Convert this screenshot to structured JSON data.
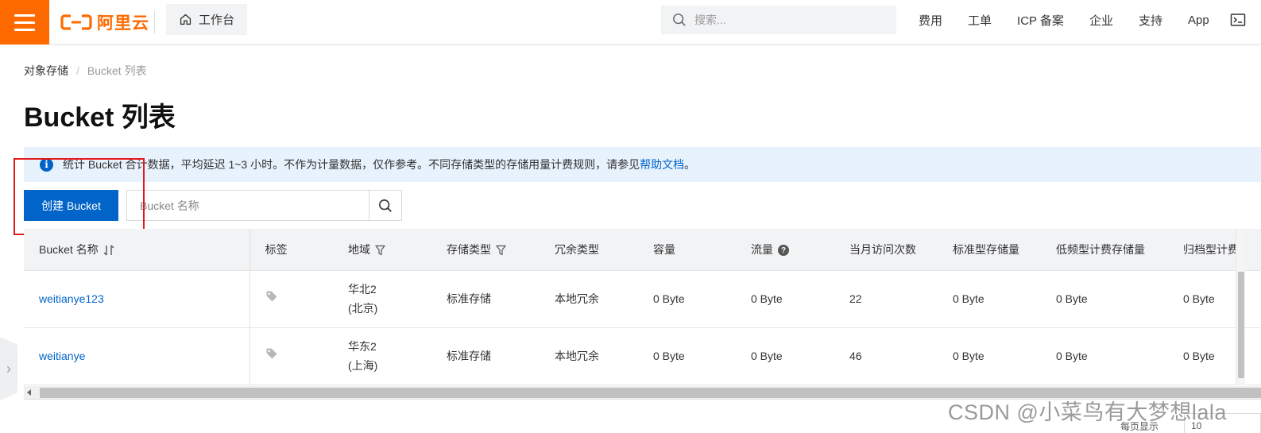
{
  "topbar": {
    "logo_text": "阿里云",
    "workbench_label": "工作台",
    "search_placeholder": "搜索...",
    "links": [
      "费用",
      "工单",
      "ICP 备案",
      "企业",
      "支持",
      "App"
    ],
    "icons": [
      "terminal-icon",
      "bell-icon"
    ],
    "brand_color": "#ff6a00"
  },
  "breadcrumb": {
    "root": "对象存储",
    "separator": "/",
    "current": "Bucket 列表"
  },
  "page_title": "Bucket 列表",
  "notice": {
    "text": "统计 Bucket 合计数据，平均延迟 1~3 小时。不作为计量数据，仅作参考。不同存储类型的存储用量计费规则，请参见",
    "link": "帮助文档",
    "suffix": "。"
  },
  "toolbar": {
    "create_label": "创建 Bucket",
    "search_placeholder": "Bucket 名称",
    "accent_color": "#0064c8"
  },
  "table": {
    "headers": [
      "Bucket 名称",
      "标签",
      "地域",
      "存储类型",
      "冗余类型",
      "容量",
      "流量",
      "当月访问次数",
      "标准型存储量",
      "低频型计费存储量",
      "归档型计费"
    ],
    "rows": [
      {
        "name": "weitianye123",
        "region_line1": "华北2",
        "region_line2": "(北京)",
        "storage_type": "标准存储",
        "redundancy": "本地冗余",
        "capacity": "0 Byte",
        "traffic": "0 Byte",
        "visits": "22",
        "standard": "0 Byte",
        "ia": "0 Byte",
        "archive": "0 Byte"
      },
      {
        "name": "weitianye",
        "region_line1": "华东2",
        "region_line2": "(上海)",
        "storage_type": "标准存储",
        "redundancy": "本地冗余",
        "capacity": "0 Byte",
        "traffic": "0 Byte",
        "visits": "46",
        "standard": "0 Byte",
        "ia": "0 Byte",
        "archive": "0 Byte"
      }
    ]
  },
  "footer": {
    "page_size_label": "每页显示",
    "page_size_value": "10"
  },
  "watermark": "CSDN @小菜鸟有大梦想lala"
}
